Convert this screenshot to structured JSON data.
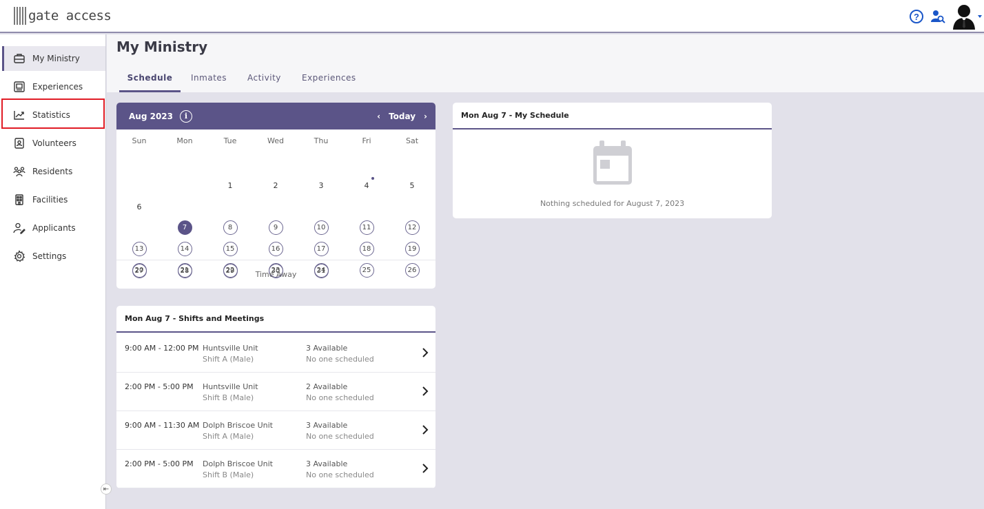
{
  "app": {
    "logo_text": "gate access"
  },
  "sidebar": {
    "items": [
      {
        "label": "My Ministry",
        "icon": "briefcase-icon"
      },
      {
        "label": "Experiences",
        "icon": "gallery-icon"
      },
      {
        "label": "Statistics",
        "icon": "chart-line-icon"
      },
      {
        "label": "Volunteers",
        "icon": "id-badge-icon"
      },
      {
        "label": "Residents",
        "icon": "users-icon"
      },
      {
        "label": "Facilities",
        "icon": "building-icon"
      },
      {
        "label": "Applicants",
        "icon": "user-edit-icon"
      },
      {
        "label": "Settings",
        "icon": "gear-icon"
      }
    ],
    "active_index": 0,
    "highlighted_index": 2
  },
  "page": {
    "title": "My Ministry",
    "tabs": [
      "Schedule",
      "Inmates",
      "Activity",
      "Experiences"
    ],
    "active_tab": 0
  },
  "calendar": {
    "month_label": "Aug 2023",
    "today_label": "Today",
    "weekdays": [
      "Sun",
      "Mon",
      "Tue",
      "Wed",
      "Thu",
      "Fri",
      "Sat"
    ],
    "selected_day": 7,
    "dot_day": 4,
    "footer": "Time Away",
    "accent_color": "#5b5488"
  },
  "my_schedule": {
    "title": "Mon Aug 7 - My Schedule",
    "empty_message": "Nothing scheduled for August 7, 2023"
  },
  "shifts": {
    "title": "Mon Aug 7 - Shifts and Meetings",
    "rows": [
      {
        "time": "9:00 AM - 12:00 PM",
        "unit": "Huntsville Unit",
        "shift": "Shift A (Male)",
        "available": "3 Available",
        "status": "No one scheduled"
      },
      {
        "time": "2:00 PM - 5:00 PM",
        "unit": "Huntsville Unit",
        "shift": "Shift B (Male)",
        "available": "2 Available",
        "status": "No one scheduled"
      },
      {
        "time": "9:00 AM - 11:30 AM",
        "unit": "Dolph Briscoe Unit",
        "shift": "Shift A (Male)",
        "available": "3 Available",
        "status": "No one scheduled"
      },
      {
        "time": "2:00 PM - 5:00 PM",
        "unit": "Dolph Briscoe Unit",
        "shift": "Shift B (Male)",
        "available": "3 Available",
        "status": "No one scheduled"
      }
    ]
  }
}
